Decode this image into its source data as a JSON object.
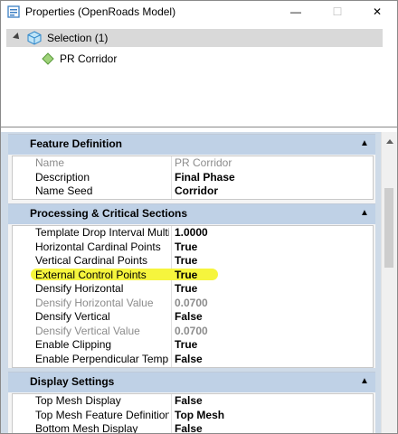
{
  "window": {
    "title": "Properties (OpenRoads Model)",
    "min": "—",
    "max": "☐",
    "close": "✕"
  },
  "tree": {
    "selection_label": "Selection (1)",
    "item_label": "PR Corridor"
  },
  "sections": [
    {
      "title": "Feature Definition",
      "rows": [
        {
          "name": "Name",
          "value": "PR Corridor",
          "disabled": true
        },
        {
          "name": "Description",
          "value": "Final Phase",
          "disabled": false
        },
        {
          "name": "Name Seed",
          "value": "Corridor",
          "disabled": false
        }
      ]
    },
    {
      "title": "Processing & Critical Sections",
      "rows": [
        {
          "name": "Template Drop Interval Multipli",
          "value": "1.0000",
          "disabled": false
        },
        {
          "name": "Horizontal Cardinal Points",
          "value": "True",
          "disabled": false
        },
        {
          "name": "Vertical Cardinal Points",
          "value": "True",
          "disabled": false
        },
        {
          "name": "External Control Points",
          "value": "True",
          "disabled": false,
          "highlighted": true
        },
        {
          "name": "Densify Horizontal",
          "value": "True",
          "disabled": false
        },
        {
          "name": "Densify Horizontal Value",
          "value": "0.0700",
          "disabled": true
        },
        {
          "name": "Densify Vertical",
          "value": "False",
          "disabled": false
        },
        {
          "name": "Densify Vertical Value",
          "value": "0.0700",
          "disabled": true
        },
        {
          "name": "Enable Clipping",
          "value": "True",
          "disabled": false
        },
        {
          "name": "Enable Perpendicular Template",
          "value": "False",
          "disabled": false
        }
      ]
    },
    {
      "title": "Display Settings",
      "rows": [
        {
          "name": "Top Mesh Display",
          "value": "False",
          "disabled": false
        },
        {
          "name": "Top Mesh Feature Definition",
          "value": "Top Mesh",
          "disabled": false
        },
        {
          "name": "Bottom Mesh Display",
          "value": "False",
          "disabled": false
        }
      ]
    }
  ],
  "colors": {
    "highlight": "#f6f53d",
    "section_header": "#bfd1e6",
    "panel_bg": "#cfdbe8"
  },
  "icons": {
    "app": "properties-cube-icon",
    "selection": "cube-icon",
    "item": "corridor-diamond-icon",
    "collapse": "chevron-up-icon"
  }
}
